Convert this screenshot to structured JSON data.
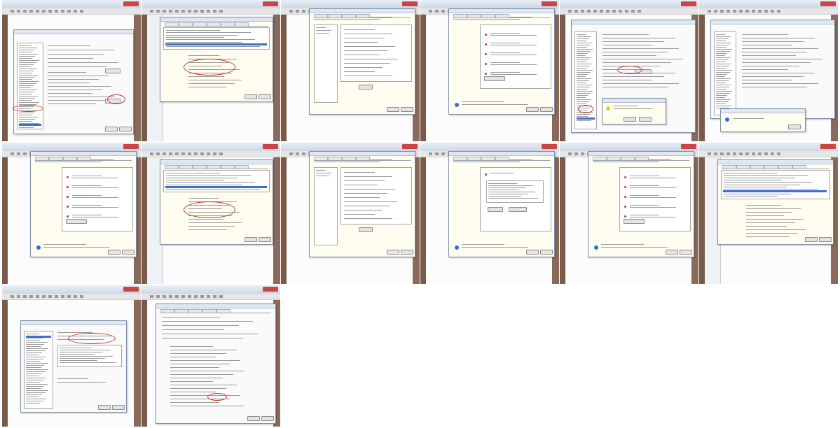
{
  "thumbnails": [
    {
      "id": "t1",
      "kind": "list-options",
      "caption": "",
      "highlight": "sidebar-item-selected",
      "circled": [
        "sidebar",
        "configure-button"
      ]
    },
    {
      "id": "t2",
      "kind": "cert-list",
      "caption": "",
      "highlight": "cert-row",
      "circled": [
        "details-block"
      ]
    },
    {
      "id": "t3",
      "kind": "wizard-props",
      "caption": "",
      "highlight": "none",
      "circled": []
    },
    {
      "id": "t4",
      "kind": "wizard-checklist",
      "caption": "",
      "highlight": "none",
      "circled": []
    },
    {
      "id": "t5",
      "kind": "settings-confirm",
      "caption": "",
      "highlight": "sidebar-item-selected",
      "circled": [
        "sidebar",
        "settings-button"
      ]
    },
    {
      "id": "t6",
      "kind": "info-box",
      "caption": "",
      "highlight": "none",
      "circled": []
    },
    {
      "id": "t7",
      "kind": "wizard-checklist",
      "caption": "",
      "highlight": "none",
      "circled": []
    },
    {
      "id": "t8",
      "kind": "cert-list",
      "caption": "",
      "highlight": "cert-row",
      "circled": [
        "details-block"
      ]
    },
    {
      "id": "t9",
      "kind": "wizard-props",
      "caption": "",
      "highlight": "none",
      "circled": []
    },
    {
      "id": "t10",
      "kind": "wizard-textbox",
      "caption": "",
      "highlight": "none",
      "circled": []
    },
    {
      "id": "t11",
      "kind": "wizard-checklist",
      "caption": "",
      "highlight": "none",
      "circled": []
    },
    {
      "id": "t12",
      "kind": "cert-list-final",
      "caption": "",
      "highlight": "cert-row",
      "circled": []
    },
    {
      "id": "t13",
      "kind": "options-list",
      "caption": "",
      "highlight": "sidebar-item-selected",
      "circled": [
        "top-fields"
      ]
    },
    {
      "id": "t14",
      "kind": "long-form",
      "caption": "",
      "highlight": "none",
      "circled": [
        "form-row"
      ]
    }
  ]
}
